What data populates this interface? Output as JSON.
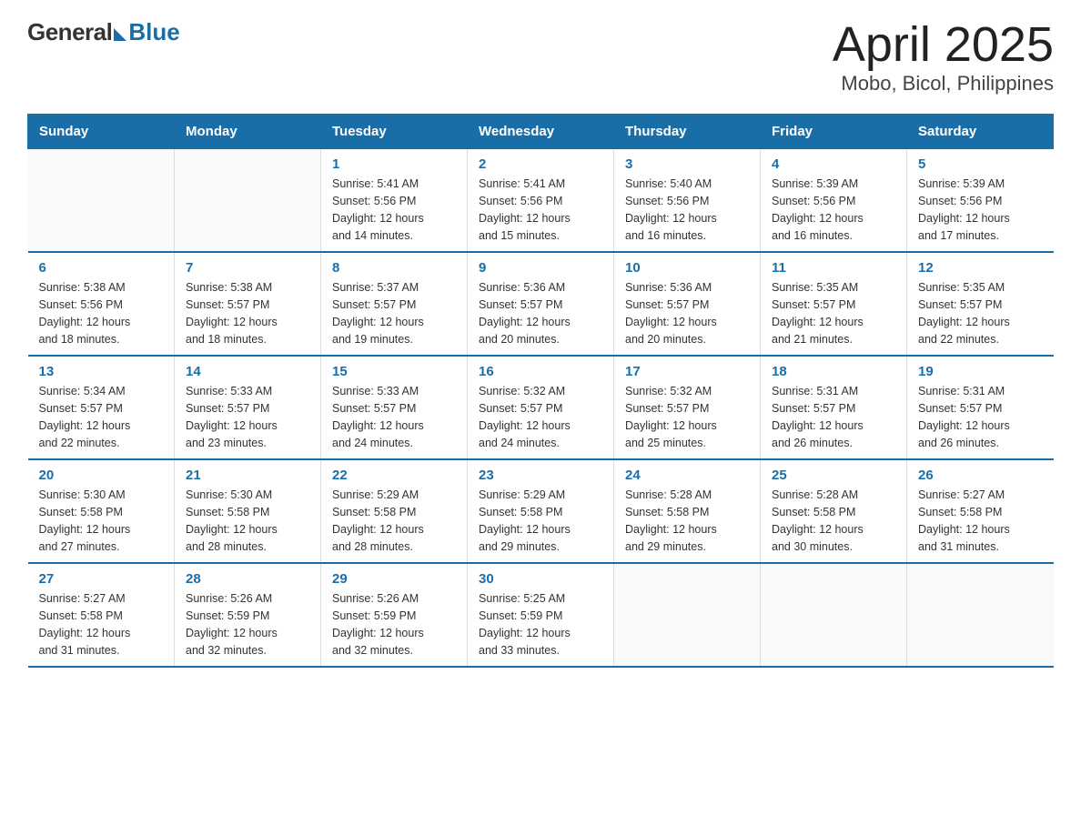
{
  "logo": {
    "general": "General",
    "blue": "Blue"
  },
  "title": "April 2025",
  "subtitle": "Mobo, Bicol, Philippines",
  "days_of_week": [
    "Sunday",
    "Monday",
    "Tuesday",
    "Wednesday",
    "Thursday",
    "Friday",
    "Saturday"
  ],
  "weeks": [
    [
      {
        "day": "",
        "info": ""
      },
      {
        "day": "",
        "info": ""
      },
      {
        "day": "1",
        "info": "Sunrise: 5:41 AM\nSunset: 5:56 PM\nDaylight: 12 hours\nand 14 minutes."
      },
      {
        "day": "2",
        "info": "Sunrise: 5:41 AM\nSunset: 5:56 PM\nDaylight: 12 hours\nand 15 minutes."
      },
      {
        "day": "3",
        "info": "Sunrise: 5:40 AM\nSunset: 5:56 PM\nDaylight: 12 hours\nand 16 minutes."
      },
      {
        "day": "4",
        "info": "Sunrise: 5:39 AM\nSunset: 5:56 PM\nDaylight: 12 hours\nand 16 minutes."
      },
      {
        "day": "5",
        "info": "Sunrise: 5:39 AM\nSunset: 5:56 PM\nDaylight: 12 hours\nand 17 minutes."
      }
    ],
    [
      {
        "day": "6",
        "info": "Sunrise: 5:38 AM\nSunset: 5:56 PM\nDaylight: 12 hours\nand 18 minutes."
      },
      {
        "day": "7",
        "info": "Sunrise: 5:38 AM\nSunset: 5:57 PM\nDaylight: 12 hours\nand 18 minutes."
      },
      {
        "day": "8",
        "info": "Sunrise: 5:37 AM\nSunset: 5:57 PM\nDaylight: 12 hours\nand 19 minutes."
      },
      {
        "day": "9",
        "info": "Sunrise: 5:36 AM\nSunset: 5:57 PM\nDaylight: 12 hours\nand 20 minutes."
      },
      {
        "day": "10",
        "info": "Sunrise: 5:36 AM\nSunset: 5:57 PM\nDaylight: 12 hours\nand 20 minutes."
      },
      {
        "day": "11",
        "info": "Sunrise: 5:35 AM\nSunset: 5:57 PM\nDaylight: 12 hours\nand 21 minutes."
      },
      {
        "day": "12",
        "info": "Sunrise: 5:35 AM\nSunset: 5:57 PM\nDaylight: 12 hours\nand 22 minutes."
      }
    ],
    [
      {
        "day": "13",
        "info": "Sunrise: 5:34 AM\nSunset: 5:57 PM\nDaylight: 12 hours\nand 22 minutes."
      },
      {
        "day": "14",
        "info": "Sunrise: 5:33 AM\nSunset: 5:57 PM\nDaylight: 12 hours\nand 23 minutes."
      },
      {
        "day": "15",
        "info": "Sunrise: 5:33 AM\nSunset: 5:57 PM\nDaylight: 12 hours\nand 24 minutes."
      },
      {
        "day": "16",
        "info": "Sunrise: 5:32 AM\nSunset: 5:57 PM\nDaylight: 12 hours\nand 24 minutes."
      },
      {
        "day": "17",
        "info": "Sunrise: 5:32 AM\nSunset: 5:57 PM\nDaylight: 12 hours\nand 25 minutes."
      },
      {
        "day": "18",
        "info": "Sunrise: 5:31 AM\nSunset: 5:57 PM\nDaylight: 12 hours\nand 26 minutes."
      },
      {
        "day": "19",
        "info": "Sunrise: 5:31 AM\nSunset: 5:57 PM\nDaylight: 12 hours\nand 26 minutes."
      }
    ],
    [
      {
        "day": "20",
        "info": "Sunrise: 5:30 AM\nSunset: 5:58 PM\nDaylight: 12 hours\nand 27 minutes."
      },
      {
        "day": "21",
        "info": "Sunrise: 5:30 AM\nSunset: 5:58 PM\nDaylight: 12 hours\nand 28 minutes."
      },
      {
        "day": "22",
        "info": "Sunrise: 5:29 AM\nSunset: 5:58 PM\nDaylight: 12 hours\nand 28 minutes."
      },
      {
        "day": "23",
        "info": "Sunrise: 5:29 AM\nSunset: 5:58 PM\nDaylight: 12 hours\nand 29 minutes."
      },
      {
        "day": "24",
        "info": "Sunrise: 5:28 AM\nSunset: 5:58 PM\nDaylight: 12 hours\nand 29 minutes."
      },
      {
        "day": "25",
        "info": "Sunrise: 5:28 AM\nSunset: 5:58 PM\nDaylight: 12 hours\nand 30 minutes."
      },
      {
        "day": "26",
        "info": "Sunrise: 5:27 AM\nSunset: 5:58 PM\nDaylight: 12 hours\nand 31 minutes."
      }
    ],
    [
      {
        "day": "27",
        "info": "Sunrise: 5:27 AM\nSunset: 5:58 PM\nDaylight: 12 hours\nand 31 minutes."
      },
      {
        "day": "28",
        "info": "Sunrise: 5:26 AM\nSunset: 5:59 PM\nDaylight: 12 hours\nand 32 minutes."
      },
      {
        "day": "29",
        "info": "Sunrise: 5:26 AM\nSunset: 5:59 PM\nDaylight: 12 hours\nand 32 minutes."
      },
      {
        "day": "30",
        "info": "Sunrise: 5:25 AM\nSunset: 5:59 PM\nDaylight: 12 hours\nand 33 minutes."
      },
      {
        "day": "",
        "info": ""
      },
      {
        "day": "",
        "info": ""
      },
      {
        "day": "",
        "info": ""
      }
    ]
  ]
}
